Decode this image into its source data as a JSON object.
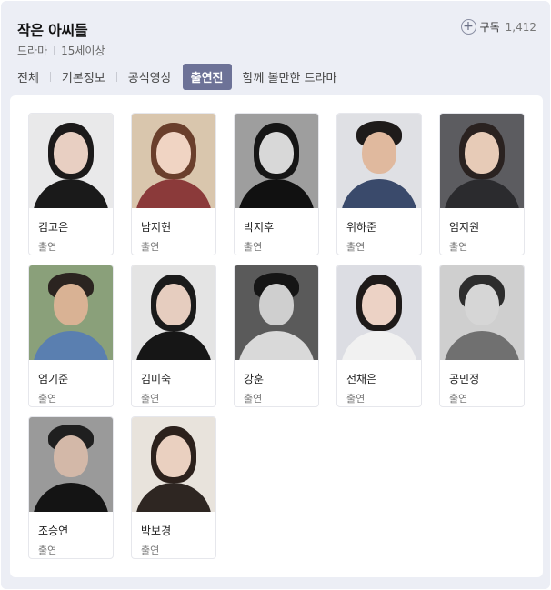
{
  "header": {
    "title": "작은 아씨들",
    "genre": "드라마",
    "rating": "15세이상",
    "subscribe_label": "구독",
    "subscribe_count": "1,412"
  },
  "tabs": [
    {
      "label": "전체"
    },
    {
      "label": "기본정보"
    },
    {
      "label": "공식영상"
    },
    {
      "label": "출연진"
    },
    {
      "label": "함께 볼만한 드라마"
    }
  ],
  "active_tab": "출연진",
  "cast": [
    {
      "name": "김고은",
      "role": "출연"
    },
    {
      "name": "남지현",
      "role": "출연"
    },
    {
      "name": "박지후",
      "role": "출연"
    },
    {
      "name": "위하준",
      "role": "출연"
    },
    {
      "name": "엄지원",
      "role": "출연"
    },
    {
      "name": "엄기준",
      "role": "출연"
    },
    {
      "name": "김미숙",
      "role": "출연"
    },
    {
      "name": "강훈",
      "role": "출연"
    },
    {
      "name": "전채은",
      "role": "출연"
    },
    {
      "name": "공민정",
      "role": "출연"
    },
    {
      "name": "조승연",
      "role": "출연"
    },
    {
      "name": "박보경",
      "role": "출연"
    }
  ],
  "colors": {
    "panel_bg": "#eceef5",
    "active_tab_bg": "#6d7297",
    "card_border": "#e6e7ec"
  }
}
